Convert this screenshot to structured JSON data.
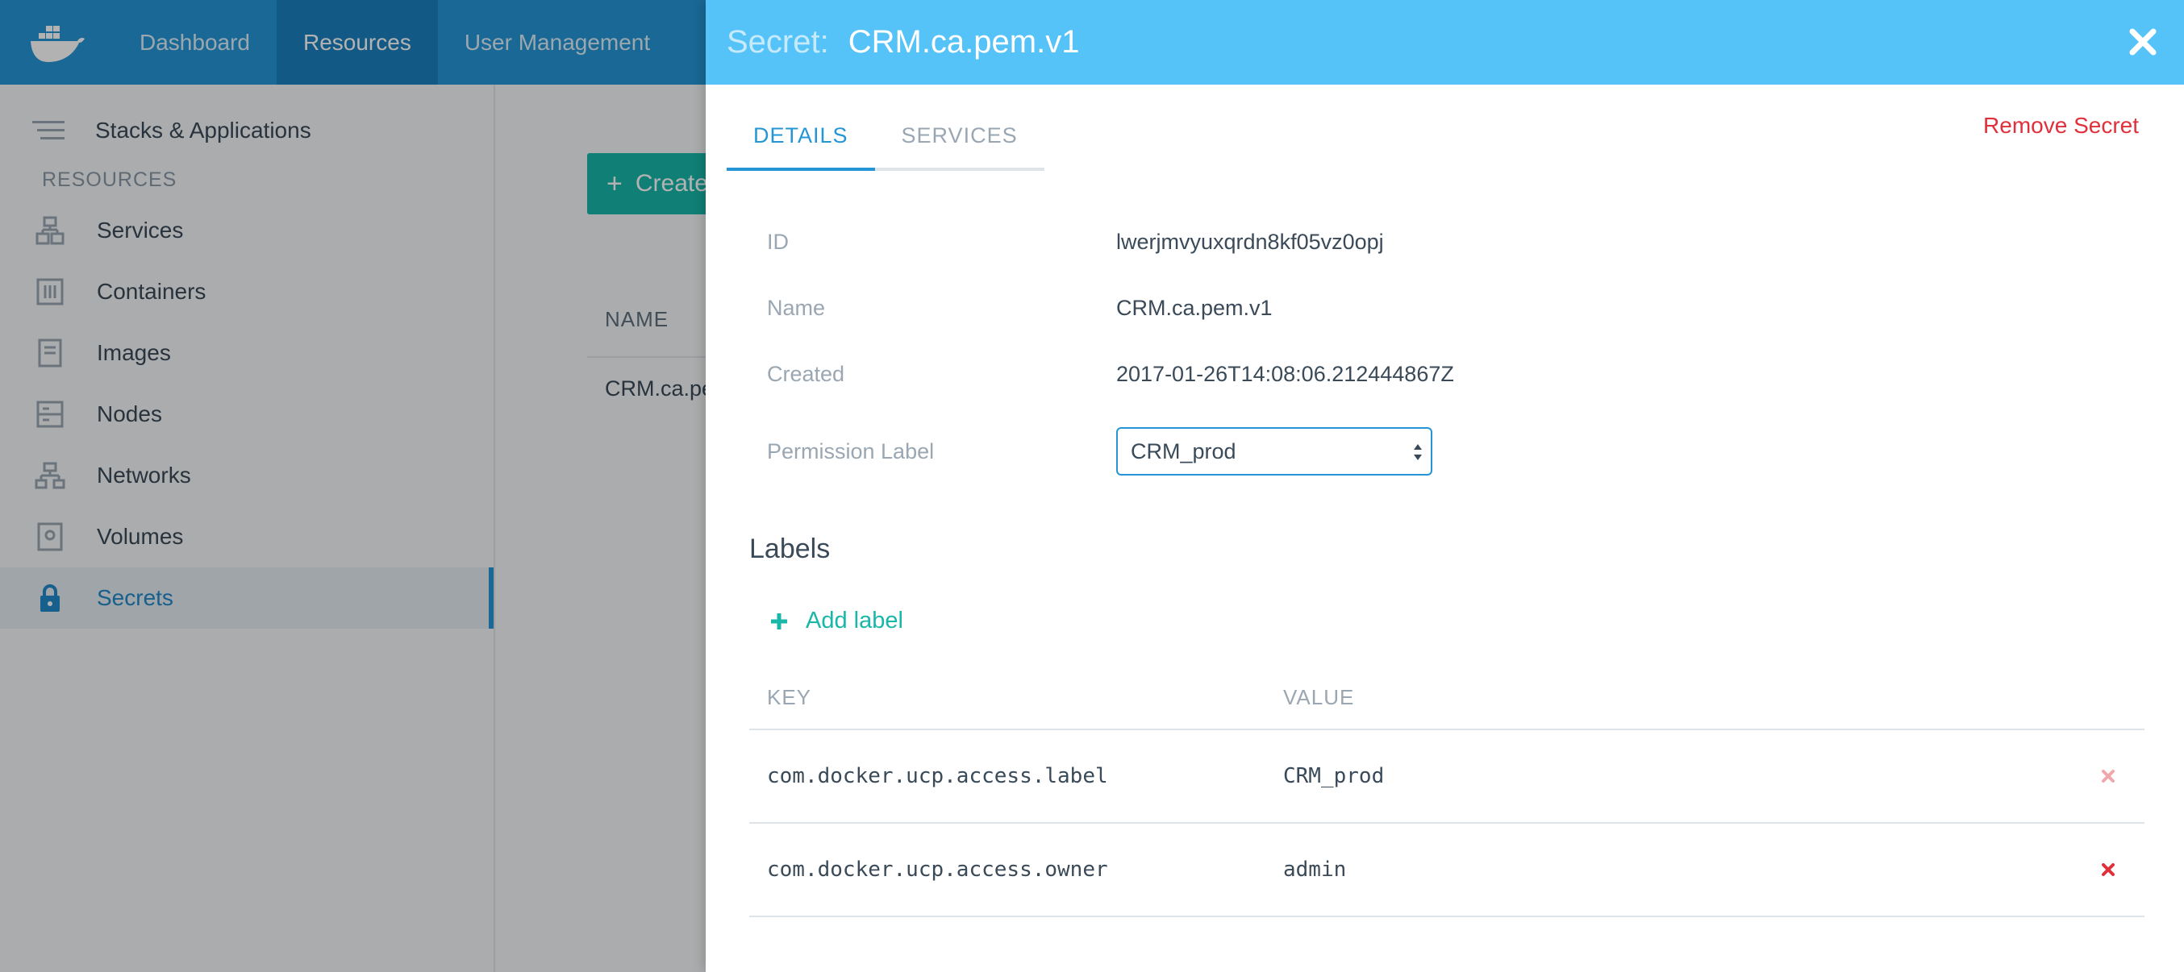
{
  "nav": {
    "logo_icon": "docker-whale-icon",
    "items": [
      {
        "label": "Dashboard"
      },
      {
        "label": "Resources"
      },
      {
        "label": "User Management"
      }
    ]
  },
  "sidebar": {
    "top_item": "Stacks & Applications",
    "heading": "RESOURCES",
    "items": [
      {
        "label": "Services",
        "icon": "services-icon"
      },
      {
        "label": "Containers",
        "icon": "containers-icon"
      },
      {
        "label": "Images",
        "icon": "images-icon"
      },
      {
        "label": "Nodes",
        "icon": "nodes-icon"
      },
      {
        "label": "Networks",
        "icon": "networks-icon"
      },
      {
        "label": "Volumes",
        "icon": "volumes-icon"
      },
      {
        "label": "Secrets",
        "icon": "lock-icon"
      }
    ]
  },
  "main": {
    "create_label": "Create",
    "column_name": "NAME",
    "row_name": "CRM.ca.pe"
  },
  "panel": {
    "title_prefix": "Secret:",
    "title": "CRM.ca.pem.v1",
    "tabs": [
      {
        "label": "DETAILS"
      },
      {
        "label": "SERVICES"
      }
    ],
    "remove_label": "Remove Secret",
    "details": {
      "id_label": "ID",
      "id_value": "lwerjmvyuxqrdn8kf05vz0opj",
      "name_label": "Name",
      "name_value": "CRM.ca.pem.v1",
      "created_label": "Created",
      "created_value": "2017-01-26T14:08:06.212444867Z",
      "permission_label": "Permission Label",
      "permission_value": "CRM_prod"
    },
    "labels": {
      "heading": "Labels",
      "add_label": "Add label",
      "columns": {
        "key": "KEY",
        "value": "VALUE"
      },
      "rows": [
        {
          "key": "com.docker.ucp.access.label",
          "value": "CRM_prod"
        },
        {
          "key": "com.docker.ucp.access.owner",
          "value": "admin"
        }
      ]
    }
  },
  "colors": {
    "nav_bg": "#2496d6",
    "panel_header_bg": "#55c3f7",
    "accent_teal": "#18b7a8",
    "danger_red": "#e0303b"
  }
}
